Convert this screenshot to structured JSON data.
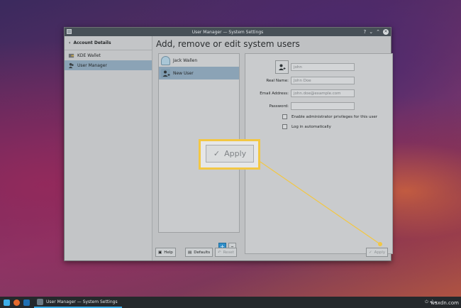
{
  "window": {
    "title": "User Manager — System Settings",
    "controls": [
      "?",
      "⌄",
      "⌃",
      "✕"
    ]
  },
  "sidebar": {
    "back_label": "Account Details",
    "items": [
      {
        "label": "KDE Wallet",
        "icon": "wallet-icon"
      },
      {
        "label": "User Manager",
        "icon": "users-icon",
        "active": true
      }
    ]
  },
  "main": {
    "title": "Add, remove or edit system users",
    "users": [
      {
        "name": "Jack Wallen",
        "active": false
      },
      {
        "name": "New User",
        "active": true
      }
    ],
    "add_label": "+",
    "remove_label": "–"
  },
  "details": {
    "username_placeholder": "john",
    "real_name_label": "Real Name:",
    "real_name_placeholder": "John Doe",
    "email_label": "Email Address:",
    "email_placeholder": "john.doe@example.com",
    "password_label": "Password:",
    "admin_checkbox": "Enable administrator privileges for this user",
    "autologin_checkbox": "Log in automatically"
  },
  "buttons": {
    "help": "Help",
    "defaults": "Defaults",
    "reset": "Reset",
    "apply": "Apply"
  },
  "callout": {
    "label": "Apply",
    "color": "#f2c744"
  },
  "taskbar": {
    "task_label": "User Manager — System Settings",
    "tray": "⏻  ◂)  ▴",
    "clock": "",
    "watermark": "wsxdn.com"
  }
}
